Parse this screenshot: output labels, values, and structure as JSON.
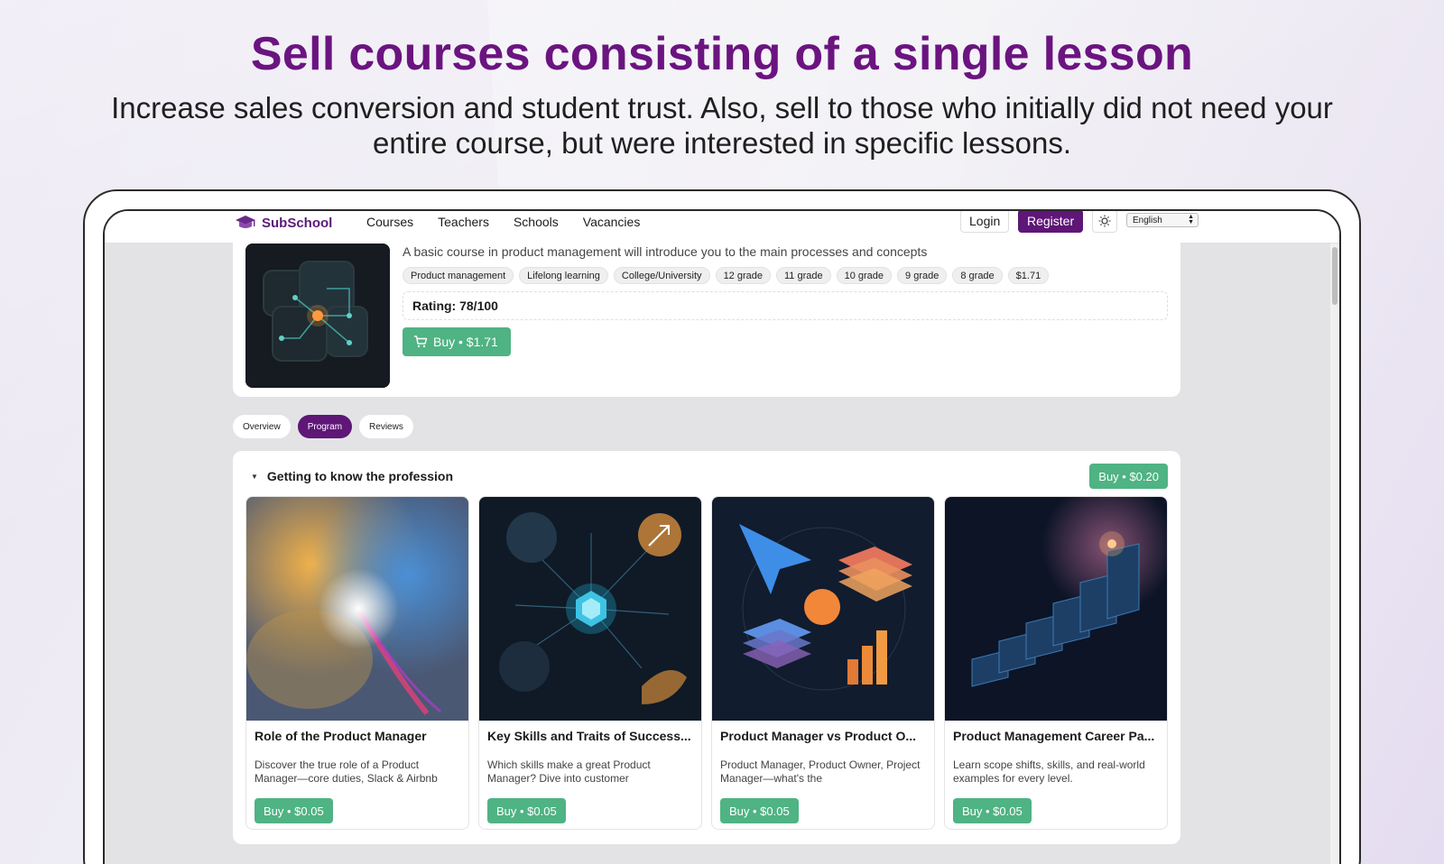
{
  "hero": {
    "title": "Sell courses consisting of a single lesson",
    "subtitle": "Increase sales conversion and student trust. Also, sell to those who initially did not need your entire course, but were interested in specific lessons."
  },
  "app": {
    "logo_text": "SubSchool",
    "nav": [
      "Courses",
      "Teachers",
      "Schools",
      "Vacancies"
    ],
    "login_label": "Login",
    "register_label": "Register",
    "language": "English"
  },
  "course": {
    "description": "A basic course in product management will introduce you to the main processes and concepts",
    "tags": [
      "Product management",
      "Lifelong learning",
      "College/University",
      "12 grade",
      "11 grade",
      "10 grade",
      "9 grade",
      "8 grade",
      "$1.71"
    ],
    "rating": "Rating: 78/100",
    "buy_label": "Buy • $1.71"
  },
  "tabs": [
    {
      "label": "Overview",
      "active": false
    },
    {
      "label": "Program",
      "active": true
    },
    {
      "label": "Reviews",
      "active": false
    }
  ],
  "section": {
    "title": "Getting to know the profession",
    "buy_label": "Buy • $0.20"
  },
  "lessons": [
    {
      "title": "Role of the Product Manager",
      "desc": "Discover the true role of a Product Manager—core duties, Slack & Airbnb",
      "buy_label": "Buy • $0.05"
    },
    {
      "title": "Key Skills and Traits of Success...",
      "desc": "Which skills make a great Product Manager? Dive into customer",
      "buy_label": "Buy • $0.05"
    },
    {
      "title": "Product Manager vs Product O...",
      "desc": "Product Manager, Product Owner, Project Manager—what's the",
      "buy_label": "Buy • $0.05"
    },
    {
      "title": "Product Management Career Pa...",
      "desc": "Learn scope shifts, skills, and real-world examples for every level.",
      "buy_label": "Buy • $0.05"
    }
  ],
  "colors": {
    "brand_purple": "#5e1677",
    "headline_purple": "#6b1480",
    "buy_green": "#4fb383"
  }
}
